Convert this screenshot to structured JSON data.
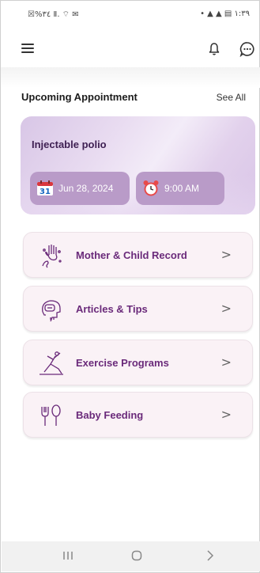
{
  "status_bar": {
    "left_text": "☒%٣٤ Ⅱ. ⌔ ✉",
    "right_text": "• ▲ ▲ ▤ ١:٣٩"
  },
  "appbar": {
    "menu_icon": "hamburger-icon",
    "bell_icon": "bell-icon",
    "chat_icon": "chat-icon"
  },
  "section": {
    "title": "Upcoming Appointment",
    "see_all": "See All"
  },
  "appointment": {
    "title": "Injectable polio",
    "date": "Jun 28, 2024",
    "calendar_day": "31",
    "time": "9:00 AM"
  },
  "menu": [
    {
      "label": "Mother & Child Record",
      "icon": "hands-icon"
    },
    {
      "label": "Articles & Tips",
      "icon": "head-bulb-icon"
    },
    {
      "label": "Exercise Programs",
      "icon": "yoga-icon"
    },
    {
      "label": "Baby Feeding",
      "icon": "bib-spoon-icon"
    }
  ],
  "chevron": ">",
  "colors": {
    "accent": "#6a2a7a",
    "chip": "#b99bc8",
    "card_bg": "#faf2f6"
  }
}
